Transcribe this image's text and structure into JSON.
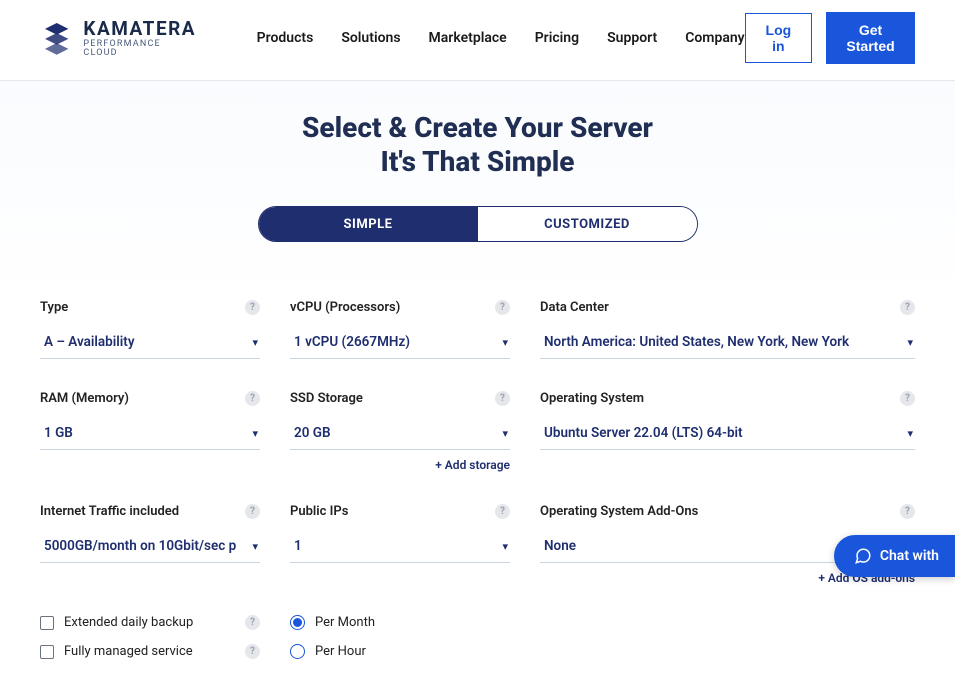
{
  "brand": {
    "name": "KAMATERA",
    "sub": "PERFORMANCE CLOUD"
  },
  "nav": [
    "Products",
    "Solutions",
    "Marketplace",
    "Pricing",
    "Support",
    "Company"
  ],
  "actions": {
    "login": "Log in",
    "cta": "Get Started"
  },
  "hero": {
    "line1": "Select & Create Your Server",
    "line2": "It's That Simple"
  },
  "toggle": {
    "simple": "SIMPLE",
    "custom": "CUSTOMIZED"
  },
  "fields": {
    "type": {
      "label": "Type",
      "value": "A – Availability"
    },
    "vcpu": {
      "label": "vCPU (Processors)",
      "value": "1 vCPU (2667MHz)"
    },
    "dc": {
      "label": "Data Center",
      "value": "North America: United States, New York, New York"
    },
    "ram": {
      "label": "RAM (Memory)",
      "value": "1 GB"
    },
    "ssd": {
      "label": "SSD Storage",
      "value": "20 GB"
    },
    "os": {
      "label": "Operating System",
      "value": "Ubuntu Server 22.04 (LTS) 64-bit"
    },
    "traffic": {
      "label": "Internet Traffic included",
      "value": "5000GB/month on 10Gbit/sec p"
    },
    "ips": {
      "label": "Public IPs",
      "value": "1"
    },
    "addons": {
      "label": "Operating System Add-Ons",
      "value": "None"
    }
  },
  "addlinks": {
    "storage": "+ Add storage",
    "addons": "+ Add OS add-ons"
  },
  "checks": {
    "backup": "Extended daily backup",
    "managed": "Fully managed service"
  },
  "billing": {
    "month": "Per Month",
    "hour": "Per Hour"
  },
  "chat": "Chat with"
}
